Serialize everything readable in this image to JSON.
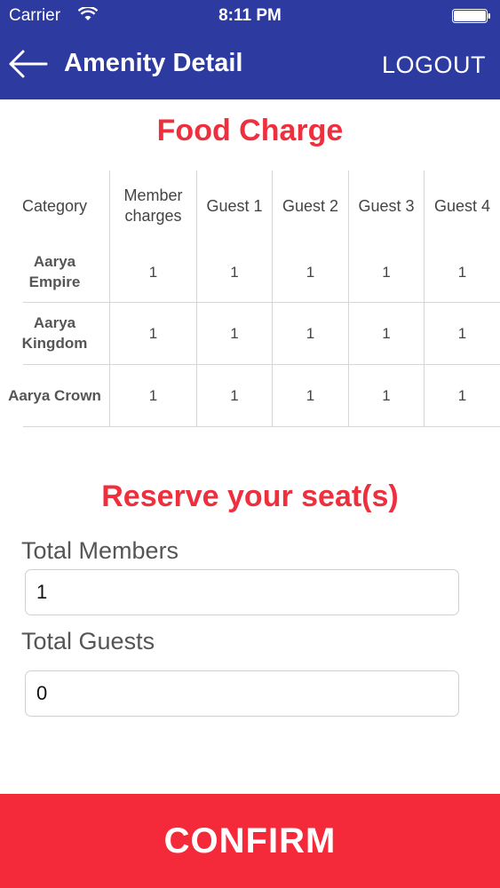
{
  "status_bar": {
    "carrier": "Carrier",
    "time": "8:11 PM"
  },
  "nav": {
    "title": "Amenity Detail",
    "logout_label": "LOGOUT",
    "back_icon": "arrow-left-icon"
  },
  "food_charge": {
    "title": "Food Charge",
    "headers": [
      "Category",
      "Member charges",
      "Guest 1",
      "Guest 2",
      "Guest 3",
      "Guest 4"
    ],
    "rows": [
      {
        "category": "Aarya Empire",
        "values": [
          "1",
          "1",
          "1",
          "1",
          "1"
        ]
      },
      {
        "category": "Aarya Kingdom",
        "values": [
          "1",
          "1",
          "1",
          "1",
          "1"
        ]
      },
      {
        "category": "Aarya Crown",
        "values": [
          "1",
          "1",
          "1",
          "1",
          "1"
        ]
      }
    ]
  },
  "reserve": {
    "title": "Reserve your seat(s)",
    "members_label": "Total Members",
    "members_value": "1",
    "guests_label": "Total Guests",
    "guests_value": "0"
  },
  "confirm_label": "CONFIRM",
  "colors": {
    "nav": "#2d3aa0",
    "accent": "#ee2f3e",
    "confirm": "#f42a3b"
  }
}
